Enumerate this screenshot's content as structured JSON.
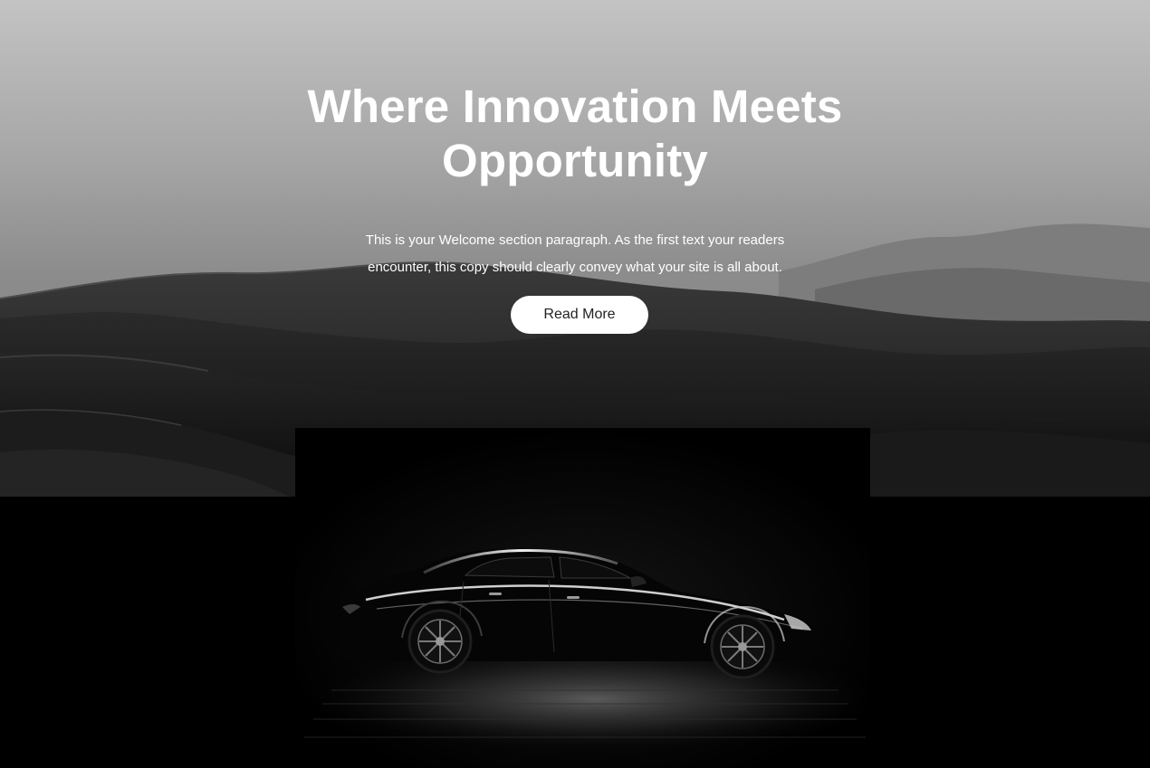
{
  "hero": {
    "title_line1": "Where Innovation Meets",
    "title_line2": "Opportunity",
    "paragraph_line1": "This is your Welcome section paragraph. As the first text your readers",
    "paragraph_line2": "encounter, this copy should clearly convey what your site is all about.",
    "button_label": "Read More",
    "background_image": "desert-dunes-monochrome",
    "colors": {
      "text": "#ffffff",
      "button_bg": "#ffffff",
      "button_text": "#222222",
      "page_bg": "#000000"
    }
  },
  "featured_image": {
    "subject": "black-sedan-silhouette"
  }
}
